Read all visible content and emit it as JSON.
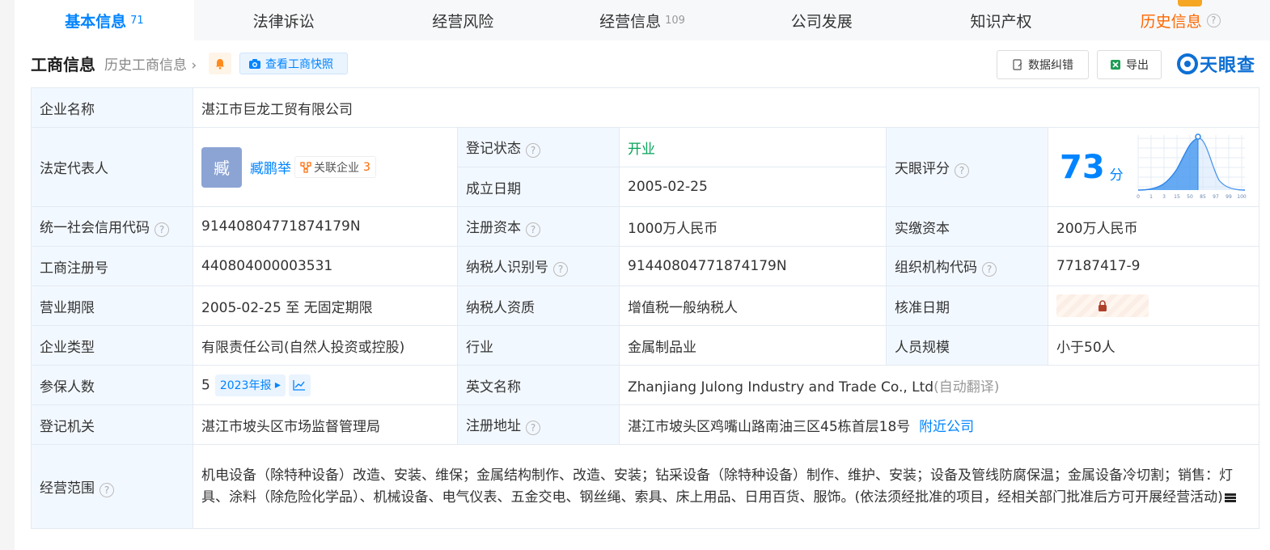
{
  "tabs": [
    {
      "label": "基本信息",
      "count": "71"
    },
    {
      "label": "法律诉讼",
      "count": ""
    },
    {
      "label": "经营风险",
      "count": ""
    },
    {
      "label": "经营信息",
      "count": "109"
    },
    {
      "label": "公司发展",
      "count": ""
    },
    {
      "label": "知识产权",
      "count": ""
    },
    {
      "label": "历史信息",
      "count": ""
    }
  ],
  "header": {
    "title": "工商信息",
    "history_link": "历史工商信息",
    "snapshot_button": "查看工商快照",
    "fix_button": "数据纠错",
    "export_button": "导出",
    "logo_text": "天眼查"
  },
  "table": {
    "company_name_label": "企业名称",
    "company_name": "湛江市巨龙工贸有限公司",
    "legal_rep_label": "法定代表人",
    "legal_rep_avatar": "臧",
    "legal_rep_name": "臧鹏举",
    "related_label": "关联企业",
    "related_count": "3",
    "reg_status_label": "登记状态",
    "reg_status": "开业",
    "found_date_label": "成立日期",
    "found_date": "2005-02-25",
    "score_label": "天眼评分",
    "score": "73",
    "score_unit": "分",
    "score_ticks": [
      "0",
      "1",
      "3",
      "15",
      "50",
      "85",
      "97",
      "99",
      "100"
    ],
    "credit_code_label": "统一社会信用代码",
    "credit_code": "91440804771874179N",
    "reg_capital_label": "注册资本",
    "reg_capital": "1000万人民币",
    "paid_capital_label": "实缴资本",
    "paid_capital": "200万人民币",
    "reg_no_label": "工商注册号",
    "reg_no": "440804000003531",
    "taxpayer_id_label": "纳税人识别号",
    "taxpayer_id": "91440804771874179N",
    "org_code_label": "组织机构代码",
    "org_code": "77187417-9",
    "term_label": "营业期限",
    "term": "2005-02-25 至 无固定期限",
    "taxpayer_qual_label": "纳税人资质",
    "taxpayer_qual": "增值税一般纳税人",
    "approve_date_label": "核准日期",
    "type_label": "企业类型",
    "type": "有限责任公司(自然人投资或控股)",
    "industry_label": "行业",
    "industry": "金属制品业",
    "staff_label": "人员规模",
    "staff": "小于50人",
    "insured_label": "参保人数",
    "insured": "5",
    "annual_report": "2023年报",
    "english_name_label": "英文名称",
    "english_name": "Zhanjiang Julong Industry and Trade Co., Ltd",
    "auto_translate": "(自动翻译)",
    "authority_label": "登记机关",
    "authority": "湛江市坡头区市场监督管理局",
    "address_label": "注册地址",
    "address": "湛江市坡头区鸡嘴山路南油三区45栋首层18号",
    "nearby": "附近公司",
    "scope_label": "经营范围",
    "scope": "机电设备（除特种设备）改造、安装、维保；金属结构制作、改造、安装；钻采设备（除特种设备）制作、维护、安装；设备及管线防腐保温；金属设备冷切割；销售：灯具、涂料（除危险化学品）、机械设备、电气仪表、五金交电、钢丝绳、索具、床上用品、日用百货、服饰。(依法须经批准的项目，经相关部门批准后方可开展经营活动)"
  },
  "colors": {
    "accent": "#0084ff",
    "status_green": "#07a35a",
    "history_orange": "#ff6700",
    "label_bg": "#f2f8ff"
  }
}
